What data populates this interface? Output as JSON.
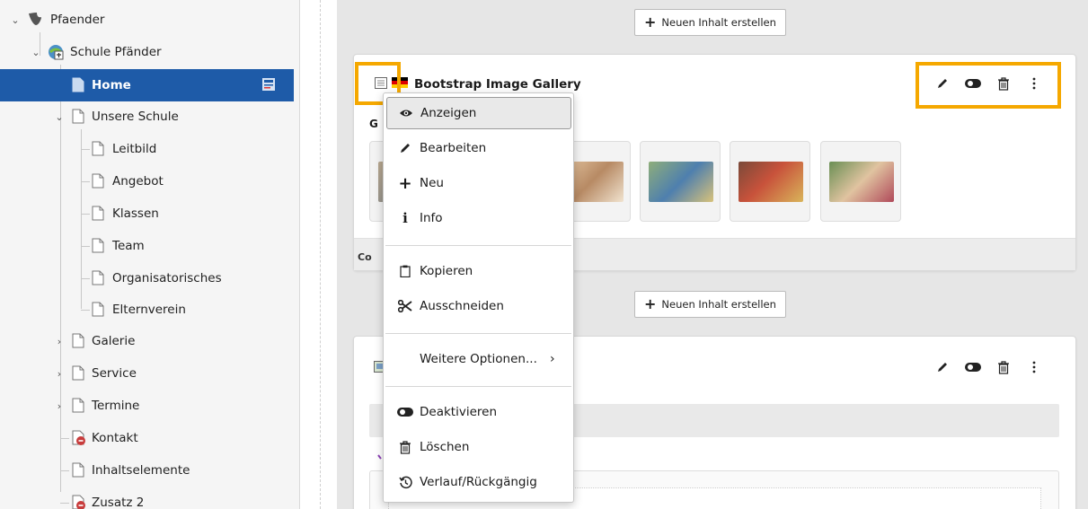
{
  "page_tree": {
    "root": {
      "label": "Pfaender",
      "icon": "typo3-logo-icon"
    },
    "site": {
      "label": "Schule Pfänder",
      "icon": "site-root-icon"
    },
    "items": [
      {
        "label": "Home",
        "icon": "page-icon",
        "active": true
      },
      {
        "label": "Unsere Schule",
        "icon": "page-icon"
      },
      {
        "label": "Leitbild",
        "icon": "page-icon"
      },
      {
        "label": "Angebot",
        "icon": "page-icon"
      },
      {
        "label": "Klassen",
        "icon": "page-icon"
      },
      {
        "label": "Team",
        "icon": "page-icon"
      },
      {
        "label": "Organisatorisches",
        "icon": "page-icon"
      },
      {
        "label": "Elternverein",
        "icon": "page-icon"
      },
      {
        "label": "Galerie",
        "icon": "page-icon"
      },
      {
        "label": "Service",
        "icon": "page-icon"
      },
      {
        "label": "Termine",
        "icon": "page-icon"
      },
      {
        "label": "Kontakt",
        "icon": "page-hidden-icon"
      },
      {
        "label": "Inhaltselemente",
        "icon": "page-icon"
      },
      {
        "label": "Zusatz 2",
        "icon": "page-hidden-icon"
      }
    ]
  },
  "content": {
    "new_content_button": "Neuen Inhalt erstellen",
    "card1": {
      "title": "Bootstrap Image Gallery",
      "header_prefix": "G",
      "footer_prefix": "Co"
    }
  },
  "context_menu": {
    "items": [
      {
        "label": "Anzeigen",
        "icon": "eye-icon"
      },
      {
        "label": "Bearbeiten",
        "icon": "pencil-icon"
      },
      {
        "label": "Neu",
        "icon": "plus-icon"
      },
      {
        "label": "Info",
        "icon": "info-icon"
      },
      {
        "label": "Kopieren",
        "icon": "clipboard-icon"
      },
      {
        "label": "Ausschneiden",
        "icon": "scissors-icon"
      },
      {
        "label": "Weitere Optionen...",
        "icon": "chevron-right-icon"
      },
      {
        "label": "Deaktivieren",
        "icon": "toggle-icon"
      },
      {
        "label": "Löschen",
        "icon": "trash-icon"
      },
      {
        "label": "Verlauf/Rückgängig",
        "icon": "history-icon"
      }
    ]
  },
  "colors": {
    "active_row": "#1e5ba8",
    "highlight": "#f5a800",
    "content_bg": "#e6e6e6"
  }
}
